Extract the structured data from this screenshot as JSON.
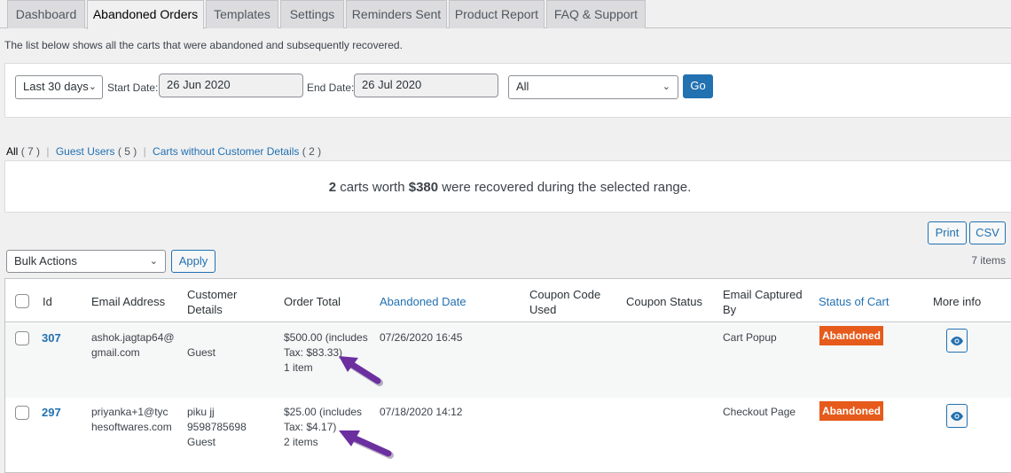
{
  "tabs": [
    {
      "label": "Dashboard",
      "active": false
    },
    {
      "label": "Abandoned Orders",
      "active": true
    },
    {
      "label": "Templates",
      "active": false
    },
    {
      "label": "Settings",
      "active": false
    },
    {
      "label": "Reminders Sent",
      "active": false
    },
    {
      "label": "Product Report",
      "active": false
    },
    {
      "label": "FAQ & Support",
      "active": false
    }
  ],
  "intro_text": "The list below shows all the carts that were abandoned and subsequently recovered.",
  "filters": {
    "range_select": "Last 30 days",
    "start_date_label": "Start Date:",
    "start_date": "26 Jun 2020",
    "end_date_label": "End Date:",
    "end_date": "26 Jul 2020",
    "type_select": "All",
    "go_label": "Go"
  },
  "views": {
    "all_label": "All",
    "all_count": "( 7 )",
    "guest_label": "Guest Users",
    "guest_count": "( 5 )",
    "nodetails_label": "Carts without Customer Details",
    "nodetails_count": "( 2 )",
    "separator": "|"
  },
  "summary": {
    "count": "2",
    "text1": " carts worth ",
    "amount": "$380",
    "text2": " were recovered during the selected range."
  },
  "actions": {
    "print_label": "Print",
    "csv_label": "CSV",
    "bulk_actions": "Bulk Actions",
    "apply_label": "Apply",
    "items_count": "7 items"
  },
  "table": {
    "columns": {
      "id": "Id",
      "email": "Email Address",
      "customer_1": "Customer",
      "customer_2": "Details",
      "order_total": "Order Total",
      "abandoned_date": "Abandoned Date",
      "coupon_code_1": "Coupon Code",
      "coupon_code_2": "Used",
      "coupon_status": "Coupon Status",
      "captured_1": "Email Captured",
      "captured_2": "By",
      "status": "Status of Cart",
      "more_info": "More info"
    },
    "rows": [
      {
        "id": "307",
        "email_1": "ashok.jagtap64@",
        "email_2": "gmail.com",
        "customer_1": "",
        "customer_2": "Guest",
        "customer_3": "",
        "total_1": "$500.00 (includes",
        "total_2": "Tax: $83.33)",
        "total_3": "1 item",
        "date": "07/26/2020 16:45",
        "coupon_code": "",
        "coupon_status": "",
        "captured_by": "Cart Popup",
        "status": "Abandoned"
      },
      {
        "id": "297",
        "email_1": "priyanka+1@tyc",
        "email_2": "hesoftwares.com",
        "customer_1": "piku jj",
        "customer_2": "9598785698",
        "customer_3": "Guest",
        "total_1": "$25.00 (includes",
        "total_2": "Tax: $4.17)",
        "total_3": "2 items",
        "date": "07/18/2020 14:12",
        "coupon_code": "",
        "coupon_status": "",
        "captured_by": "Checkout Page",
        "status": "Abandoned"
      }
    ]
  },
  "colors": {
    "accent": "#2271b1",
    "status_abandoned": "#e65b1b",
    "annotation_arrow": "#6b2fa0"
  }
}
